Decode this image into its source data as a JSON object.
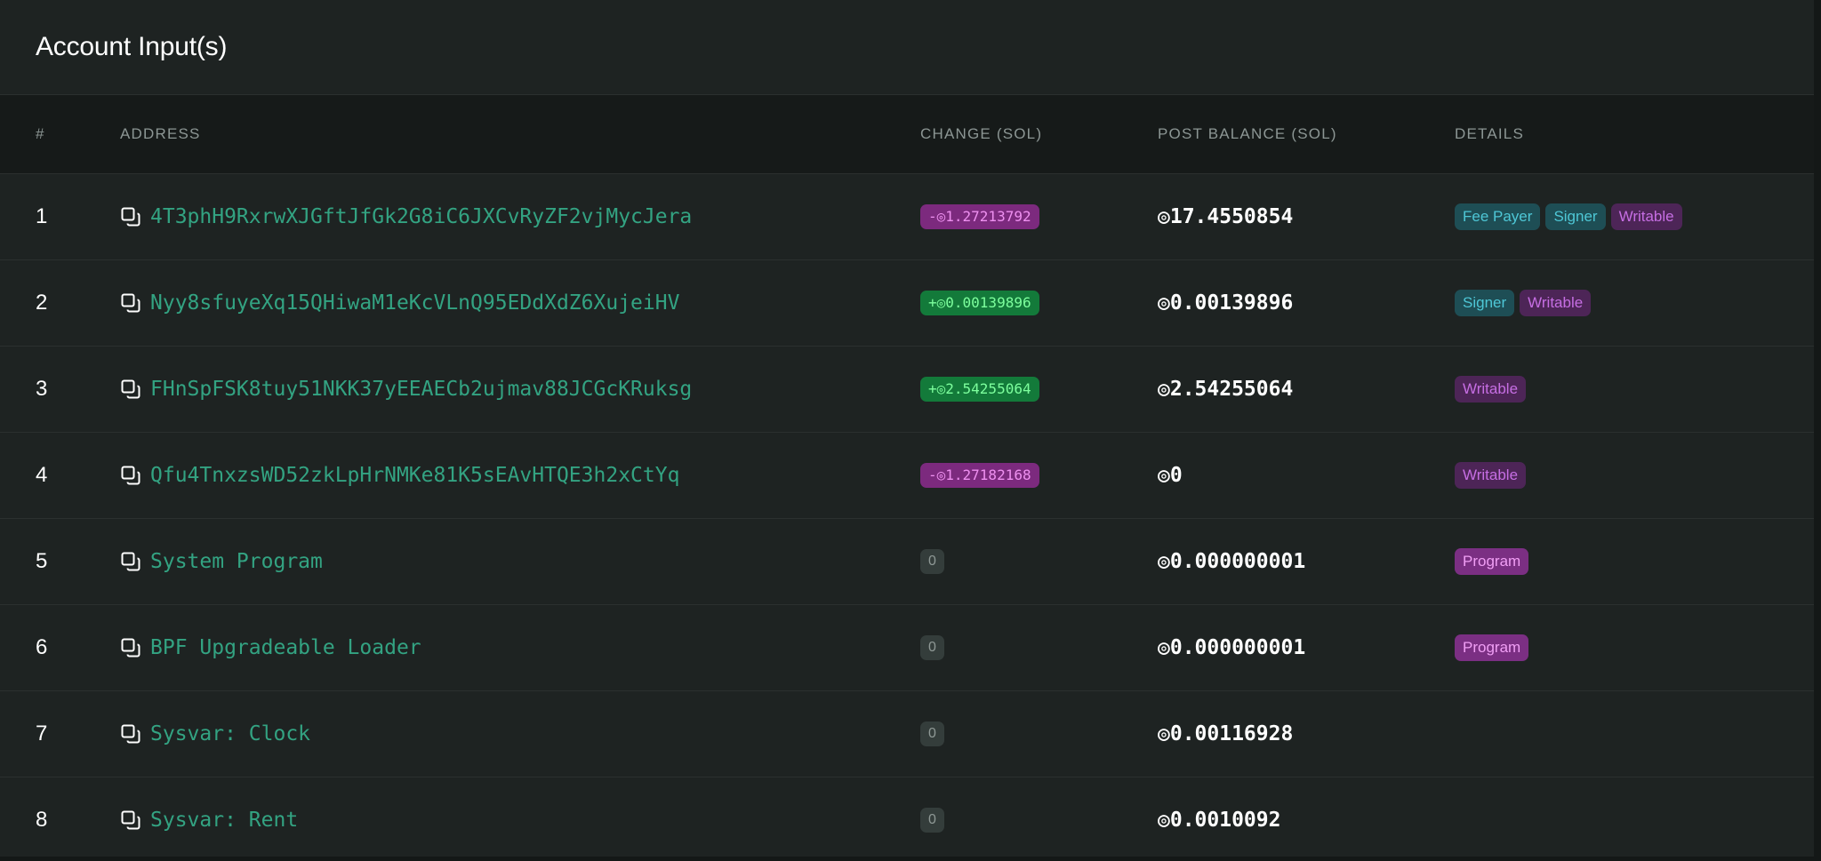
{
  "card": {
    "title": "Account Input(s)"
  },
  "columns": {
    "num": "#",
    "address": "ADDRESS",
    "change": "CHANGE (SOL)",
    "post_balance": "POST BALANCE (SOL)",
    "details": "DETAILS"
  },
  "rows": [
    {
      "num": "1",
      "address": "4T3phH9RxrwXJGftJfGk2G8iC6JXCvRyZF2vjMycJera",
      "change": "-◎1.27213792",
      "change_kind": "neg",
      "post": "◎17.4550854",
      "details": [
        "Fee Payer",
        "Signer",
        "Writable"
      ]
    },
    {
      "num": "2",
      "address": "Nyy8sfuyeXq15QHiwaM1eKcVLnQ95EDdXdZ6XujeiHV",
      "change": "+◎0.00139896",
      "change_kind": "pos",
      "post": "◎0.00139896",
      "details": [
        "Signer",
        "Writable"
      ]
    },
    {
      "num": "3",
      "address": "FHnSpFSK8tuy51NKK37yEEAECb2ujmav88JCGcKRuksg",
      "change": "+◎2.54255064",
      "change_kind": "pos",
      "post": "◎2.54255064",
      "details": [
        "Writable"
      ]
    },
    {
      "num": "4",
      "address": "Qfu4TnxzsWD52zkLpHrNMKe81K5sEAvHTQE3h2xCtYq",
      "change": "-◎1.27182168",
      "change_kind": "neg",
      "post": "◎0",
      "details": [
        "Writable"
      ]
    },
    {
      "num": "5",
      "address": "System Program",
      "change": "0",
      "change_kind": "zero",
      "post": "◎0.000000001",
      "details": [
        "Program"
      ]
    },
    {
      "num": "6",
      "address": "BPF Upgradeable Loader",
      "change": "0",
      "change_kind": "zero",
      "post": "◎0.000000001",
      "details": [
        "Program"
      ]
    },
    {
      "num": "7",
      "address": "Sysvar: Clock",
      "change": "0",
      "change_kind": "zero",
      "post": "◎0.00116928",
      "details": []
    },
    {
      "num": "8",
      "address": "Sysvar: Rent",
      "change": "0",
      "change_kind": "zero",
      "post": "◎0.0010092",
      "details": []
    }
  ],
  "colors": {
    "address": "#33a382",
    "negative_chip": "#7c2a7e",
    "positive_chip": "#137a3a",
    "signer_badge": "#1e4e55",
    "writable_badge": "#4d2557",
    "program_badge": "#7b2f83"
  },
  "icons": {
    "copy": "copy-icon"
  }
}
